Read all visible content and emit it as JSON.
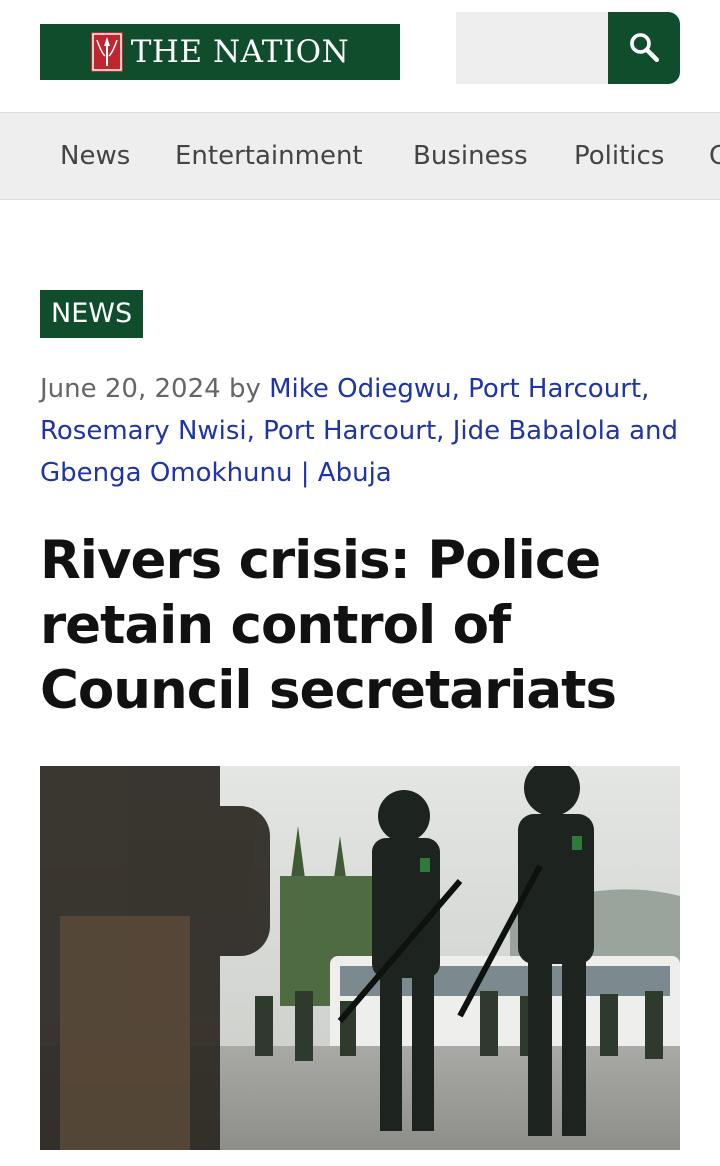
{
  "header": {
    "logo_text": "THE NATION",
    "search": {
      "placeholder": "",
      "button_icon": "search-icon"
    },
    "brand_color": "#0f4d2d"
  },
  "nav": {
    "items": [
      {
        "label": "News"
      },
      {
        "label": "Entertainment"
      },
      {
        "label": "Business"
      },
      {
        "label": "Politics"
      },
      {
        "label": "C"
      }
    ]
  },
  "article": {
    "category": "NEWS",
    "date": "June 20, 2024",
    "by": "by",
    "authors": [
      "Mike Odiegwu, Port Harcourt,",
      "Rosemary Nwisi, Port Harcourt,",
      "Jide Babalola",
      "and",
      "Gbenga Omokhunu",
      "|",
      "Abuja"
    ],
    "headline": "Rivers crisis: Police retain control of Council secretariats",
    "hero_image": "police-officers-photo",
    "link_color": "#1f35a6"
  }
}
